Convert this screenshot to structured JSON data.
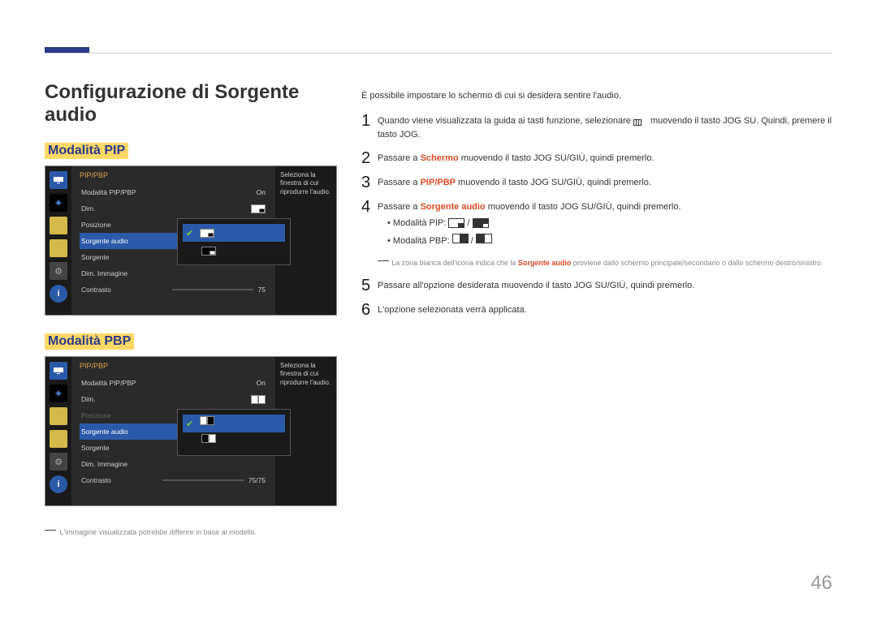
{
  "page_number": "46",
  "main_title": "Configurazione di Sorgente audio",
  "footnote": "L'immagine visualizzata potrebbe differire in base al modello.",
  "pip": {
    "title": "Modalità PIP",
    "osd_title": "PIP/PBP",
    "info": "Seleziona la finestra di cui riprodurre l'audio.",
    "rows": {
      "mode_label": "Modalità PIP/PBP",
      "mode_val": "On",
      "dim_label": "Dim.",
      "pos_label": "Posizione",
      "audio_label": "Sorgente audio",
      "src_label": "Sorgente",
      "imgsize_label": "Dim. Immagine",
      "contrast_label": "Contrasto",
      "contrast_val": "75"
    }
  },
  "pbp": {
    "title": "Modalità PBP",
    "osd_title": "PIP/PBP",
    "info": "Seleziona la finestra di cui riprodurre l'audio.",
    "rows": {
      "mode_label": "Modalità PIP/PBP",
      "mode_val": "On",
      "dim_label": "Dim.",
      "pos_label": "Posizione",
      "audio_label": "Sorgente audio",
      "src_label": "Sorgente",
      "imgsize_label": "Dim. Immagine",
      "contrast_label": "Contrasto",
      "contrast_val": "75/75"
    }
  },
  "right": {
    "intro": "È possibile impostare lo schermo di cui si desidera sentire l'audio.",
    "step1_a": "Quando viene visualizzata la guida ai tasti funzione, selezionare ",
    "step1_b": " muovendo il tasto JOG SU. Quindi, premere il tasto JOG.",
    "step2_a": "Passare a ",
    "step2_b": "Schermo",
    "step2_c": " muovendo il tasto JOG SU/GIÙ, quindi premerlo.",
    "step3_a": "Passare a ",
    "step3_b": "PIP/PBP",
    "step3_c": " muovendo il tasto JOG SU/GIÙ, quindi premerlo.",
    "step4_a": "Passare a ",
    "step4_b": "Sorgente audio",
    "step4_c": " muovendo il tasto JOG SU/GIÙ, quindi premerlo.",
    "bullet1": "Modalità PIP: ",
    "bullet2": "Modalità PBP: ",
    "note_a": "La zona bianca dell'icona indica che la ",
    "note_b": "Sorgente audio",
    "note_c": " proviene dallo schermo principale/secondario o dallo schermo destro/sinistro.",
    "step5": "Passare all'opzione desiderata muovendo il tasto JOG SU/GIÙ, quindi premerlo.",
    "step6": "L'opzione selezionata verrà applicata."
  }
}
